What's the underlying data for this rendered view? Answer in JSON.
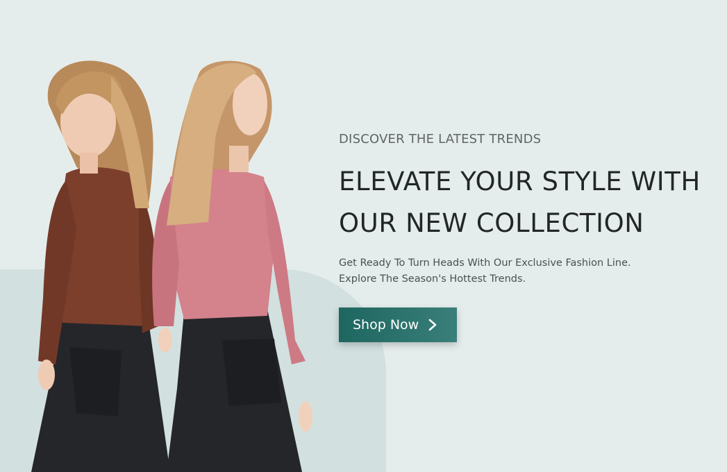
{
  "hero": {
    "eyebrow": "DISCOVER THE LATEST TRENDS",
    "headline_line1": "ELEVATE YOUR STYLE WITH",
    "headline_line2": "OUR NEW COLLECTION",
    "description_line1": "Get Ready To Turn Heads With Our Exclusive Fashion Line.",
    "description_line2": "Explore The Season's Hottest Trends.",
    "cta_label": "Shop Now",
    "cta_icon": "chevron-right-icon",
    "image_alt": "Two models wearing long-sleeve tops and dark jeans"
  },
  "colors": {
    "page_background": "#e5edec",
    "shape_background": "#d2e0df",
    "headline": "#222626",
    "eyebrow": "#5f6363",
    "button_start": "#1e6660",
    "button_end": "#3a7f79",
    "button_text": "#ffffff",
    "top_left_model": "#7c3f2c",
    "top_right_model": "#d4828b",
    "jeans": "#25262a"
  }
}
